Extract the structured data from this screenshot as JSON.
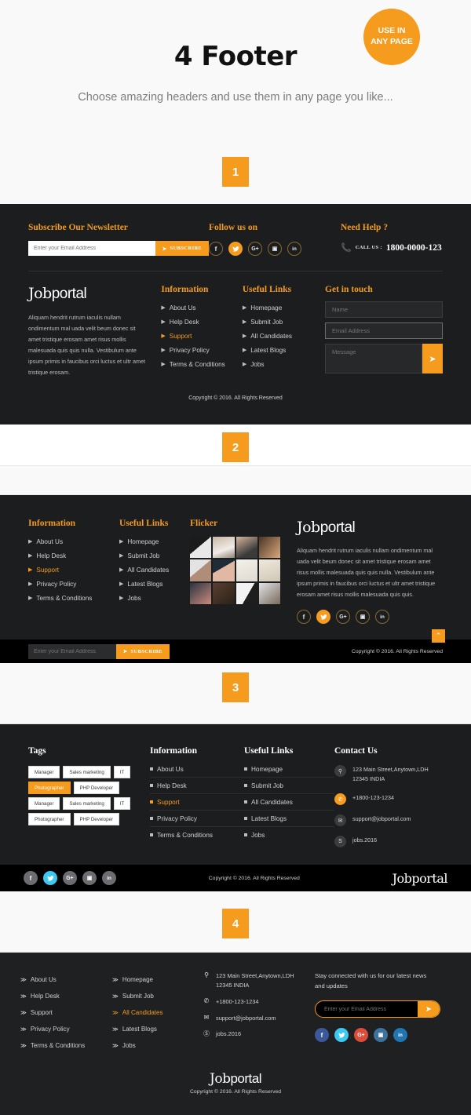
{
  "hero": {
    "title": "4 Footer",
    "subtitle": "Choose amazing headers and use them in any page you like...",
    "badge_line1": "USE IN",
    "badge_line2": "ANY PAGE",
    "accent": "#f59b1e"
  },
  "steps": {
    "one": "1",
    "two": "2",
    "three": "3",
    "four": "4"
  },
  "brand": {
    "bold": "Job",
    "thin": "portal"
  },
  "copyright": "Copyright © 2016. All Rights Reserved",
  "newsletter": {
    "heading": "Subscribe Our Newsletter",
    "placeholder": "Enter your Email Address",
    "button": "SUBSCRIBE"
  },
  "follow": {
    "heading": "Follow us on",
    "items": [
      {
        "name": "facebook",
        "glyph": "f"
      },
      {
        "name": "twitter",
        "glyph": "🐦"
      },
      {
        "name": "google-plus",
        "glyph": "G+"
      },
      {
        "name": "instagram",
        "glyph": "▣"
      },
      {
        "name": "linkedin",
        "glyph": "in"
      }
    ]
  },
  "help": {
    "heading": "Need Help ?",
    "call_label": "CALL US :",
    "number": "1800-0000-123"
  },
  "about": {
    "text": "Aliquam hendrit rutrum iaculis nullam ondimentum mal uada velit beum donec sit amet tristique erosam amet risus mollis malesuada quis quis nulla. Vestibulum ante ipsum primis in faucibus orci luctus et ultr amet tristique erosam."
  },
  "about_wide": {
    "text": "Aliquam hendrit rutrum iaculis nullam ondimentum mal uada velit beum donec sit amet tristique erosam amet risus mollis malesuada quis quis nulla. Vestibulum ante ipsum primis in faucibus orci luctus et ultr amet tristique erosam amet risus mollis malesuada quis quis."
  },
  "information": {
    "heading": "Information",
    "items": [
      {
        "label": "About Us",
        "active": false
      },
      {
        "label": "Help Desk",
        "active": false
      },
      {
        "label": "Support",
        "active": true
      },
      {
        "label": "Privacy Policy",
        "active": false
      },
      {
        "label": "Terms & Conditions",
        "active": false
      }
    ]
  },
  "useful": {
    "heading": "Useful Links",
    "items": [
      {
        "label": "Homepage",
        "active": false
      },
      {
        "label": "Submit Job",
        "active": false
      },
      {
        "label": "All Candidates",
        "active": false
      },
      {
        "label": "Latest Blogs",
        "active": false
      },
      {
        "label": "Jobs",
        "active": false
      }
    ]
  },
  "useful_s4": {
    "heading": "Useful Links",
    "items": [
      {
        "label": "Homepage",
        "active": false
      },
      {
        "label": "Submit Job",
        "active": false
      },
      {
        "label": "All Candidates",
        "active": true
      },
      {
        "label": "Latest Blogs",
        "active": false
      },
      {
        "label": "Jobs",
        "active": false
      }
    ]
  },
  "get_in_touch": {
    "heading": "Get in touch",
    "name_placeholder": "Name",
    "email_placeholder": "Email Address",
    "message_placeholder": "Message",
    "send_icon": "send-icon"
  },
  "flicker": {
    "heading": "Flicker",
    "count": 12
  },
  "tags": {
    "heading": "Tags",
    "items": [
      {
        "label": "Manager",
        "active": false
      },
      {
        "label": "Sales marketing",
        "active": false
      },
      {
        "label": "IT",
        "active": false
      },
      {
        "label": "Photographer",
        "active": true
      },
      {
        "label": "PHP Developer",
        "active": false
      },
      {
        "label": "Manager",
        "active": false
      },
      {
        "label": "Sales marketing",
        "active": false
      },
      {
        "label": "IT",
        "active": false
      },
      {
        "label": "Photographer",
        "active": false
      },
      {
        "label": "PHP Developer",
        "active": false
      }
    ]
  },
  "contact": {
    "heading": "Contact Us",
    "address_line1": "123 Main Street,Anytown,LDH",
    "address_line2": "12345 INDIA",
    "phone": "+1800-123-1234",
    "email": "support@jobportal.com",
    "skype": "jobs.2016"
  },
  "stay": {
    "text": "Stay connected with us for our latest news and updates",
    "placeholder": "Enter your Email Address"
  },
  "top_button": {
    "name": "scroll-to-top",
    "glyph": "⌃"
  }
}
